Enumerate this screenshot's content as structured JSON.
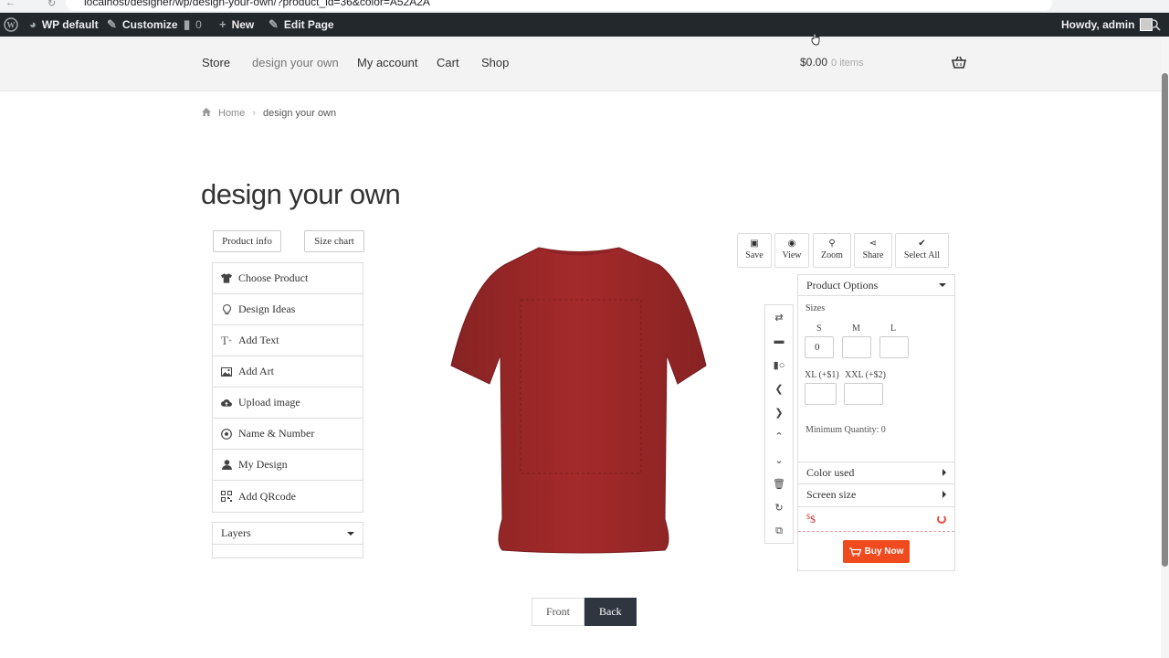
{
  "browser": {
    "url": "localhost/designer/wp/design-your-own/?product_id=36&color=A52A2A"
  },
  "adminbar": {
    "site_name": "WP default",
    "customize": "Customize",
    "comments_count": "0",
    "new_label": "New",
    "edit_page": "Edit Page",
    "greeting": "Howdy, admin"
  },
  "header": {
    "nav": [
      "Store",
      "design your own",
      "My account",
      "Cart",
      "Shop"
    ],
    "cart_total": "$0.00",
    "cart_count": "0 items"
  },
  "breadcrumb": {
    "home": "Home",
    "current": "design your own"
  },
  "page": {
    "title": "design your own"
  },
  "designer": {
    "product_info": "Product info",
    "size_chart": "Size chart",
    "menu": [
      {
        "label": "Choose Product",
        "icon": "tshirt-icon"
      },
      {
        "label": "Design Ideas",
        "icon": "lightbulb-icon"
      },
      {
        "label": "Add Text",
        "icon": "text-icon"
      },
      {
        "label": "Add Art",
        "icon": "image-icon"
      },
      {
        "label": "Upload image",
        "icon": "upload-cloud-icon"
      },
      {
        "label": "Name & Number",
        "icon": "ball-icon"
      },
      {
        "label": "My Design",
        "icon": "user-icon"
      },
      {
        "label": "Add QRcode",
        "icon": "qrcode-icon"
      }
    ],
    "layers_label": "Layers",
    "shirt_color": "#a52a2a",
    "toolbar": {
      "save": "Save",
      "view": "View",
      "zoom": "Zoom",
      "share": "Share",
      "select_all": "Select All"
    },
    "options": {
      "title": "Product Options",
      "sizes_label": "Sizes",
      "size_s": "S",
      "size_m": "M",
      "size_l": "L",
      "size_s_value": "0",
      "size_xl": "XL (+$1)",
      "size_xxl": "XXL (+$2)",
      "minimum": "Minimum Quantity: 0",
      "color_used": "Color used",
      "screen_size": "Screen size",
      "price": "$",
      "buy_now": "Buy Now"
    },
    "view_front": "Front",
    "view_back": "Back"
  }
}
